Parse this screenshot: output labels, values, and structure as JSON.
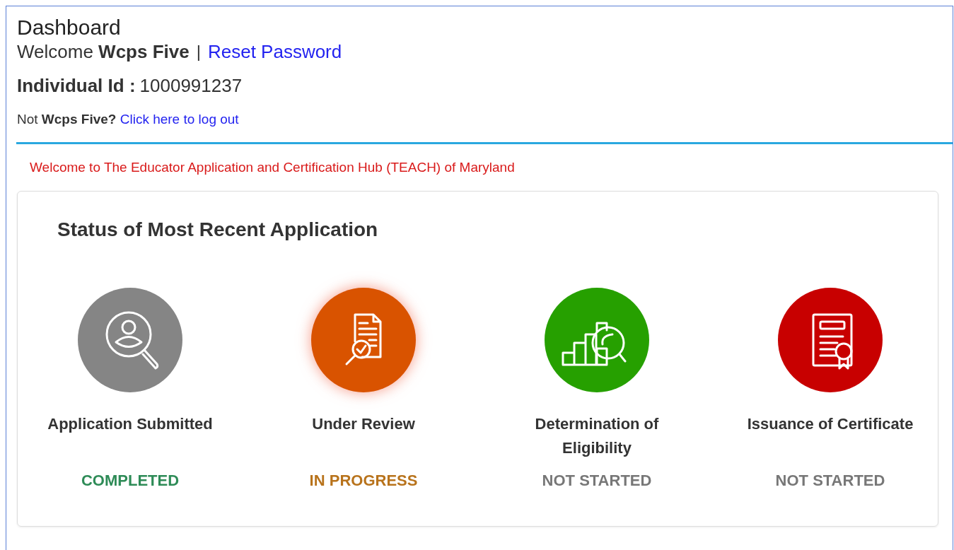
{
  "header": {
    "title": "Dashboard",
    "welcome": "Welcome **Wcps Five**",
    "separator": "|",
    "reset_link": "Reset Password",
    "id_label": "Individual Id :",
    "id_value": "1000991237",
    "not_user": "Not **Wcps Five?**",
    "logout_link": "Click here to log out"
  },
  "banner": "Welcome to The Educator Application and Certification Hub (TEACH) of Maryland",
  "status_card": {
    "title": "Status of Most Recent Application",
    "steps": [
      {
        "kind": "search-person",
        "label": "Application Submitted",
        "status": {
          "text": "COMPLETED",
          "color": "#2e8b57"
        },
        "color": "#858585",
        "current": false
      },
      {
        "kind": "document-review",
        "label": "Under Review",
        "status": {
          "text": "IN PROGRESS",
          "color": "#b8731c"
        },
        "color": "#d95300",
        "current": true
      },
      {
        "kind": "chart-search",
        "label": "Determination of Eligibility",
        "status": {
          "text": "NOT STARTED",
          "color": "#777777"
        },
        "color": "#26a000",
        "current": false
      },
      {
        "kind": "certificate",
        "label": "Issuance of Certificate",
        "status": {
          "text": "NOT STARTED",
          "color": "#777777"
        },
        "color": "#c80000",
        "current": false
      }
    ]
  }
}
